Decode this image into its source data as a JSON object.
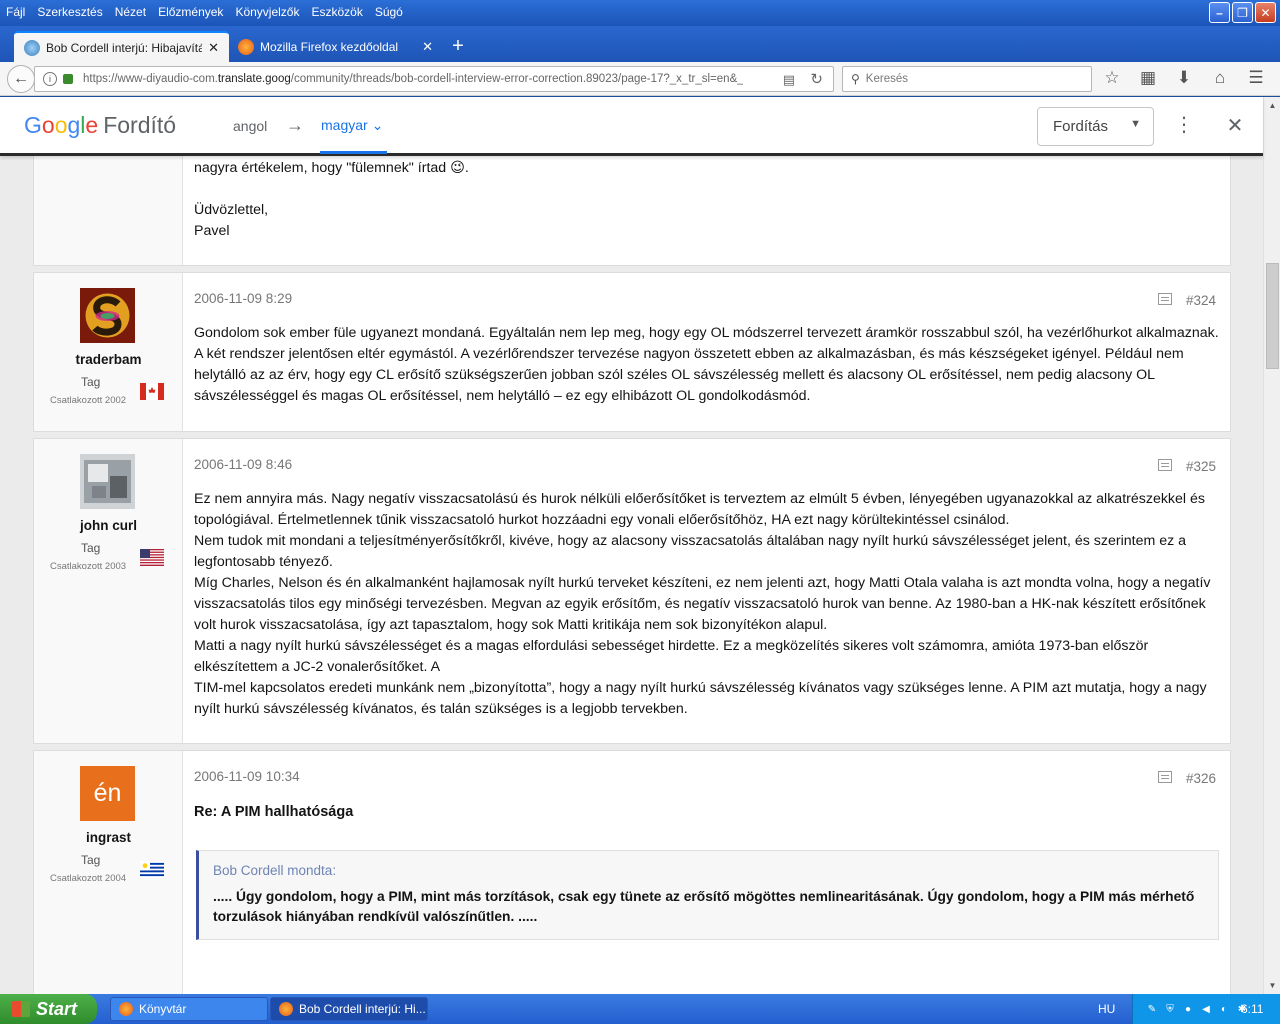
{
  "menu": [
    "Fájl",
    "Szerkesztés",
    "Nézet",
    "Előzmények",
    "Könyvjelzők",
    "Eszközök",
    "Súgó"
  ],
  "tabs": [
    {
      "title": "Bob Cordell interjú: Hibajavítá..."
    },
    {
      "title": "Mozilla Firefox kezdőoldal"
    }
  ],
  "nav": {
    "url_prefix": "https://www-diyaudio-com.",
    "url_domain": "translate.goog",
    "url_rest": "/community/threads/bob-cordell-interview-error-correction.89023/page-17?_x_tr_sl=en&_x_tr_",
    "search_placeholder": "Keresés"
  },
  "translate_bar": {
    "logo_letters": [
      "G",
      "o",
      "o",
      "g",
      "l",
      "e"
    ],
    "product": "Fordító",
    "source_lang": "angol",
    "target_lang": "magyar",
    "action": "Fordítás"
  },
  "posts": [
    {
      "body_lines": [
        "nagyra értékelem, hogy \"fülemnek\" írtad 😉.",
        "",
        "Üdvözlettel,",
        "Pavel"
      ]
    },
    {
      "user": "traderbam",
      "title": "Tag",
      "joined": "Csatlakozott 2002",
      "date": "2006-11-09 8:29",
      "num": "#324",
      "body": "Gondolom sok ember füle ugyanezt mondaná. Egyáltalán nem lep meg, hogy egy OL módszerrel tervezett áramkör rosszabbul szól, ha vezérlőhurkot alkalmaznak. A két rendszer jelentősen eltér egymástól. A vezérlőrendszer tervezése nagyon összetett ebben az alkalmazásban, és más készségeket igényel. Például nem helytálló az az érv, hogy egy CL erősítő szükségszerűen jobban szól széles OL sávszélesség mellett és alacsony OL erősítéssel, nem pedig alacsony OL sávszélességgel és magas OL erősítéssel, nem helytálló – ez egy elhibázott OL gondolkodásmód."
    },
    {
      "user": "john curl",
      "title": "Tag",
      "joined": "Csatlakozott 2003",
      "date": "2006-11-09 8:46",
      "num": "#325",
      "paragraphs": [
        "Ez nem annyira más. Nagy negatív visszacsatolású és hurok nélküli előerősítőket is terveztem az elmúlt 5 évben, lényegében ugyanazokkal az alkatrészekkel és topológiával. Értelmetlennek tűnik visszacsatoló hurkot hozzáadni egy vonali előerősítőhöz, HA ezt nagy körültekintéssel csinálod.",
        "Nem tudok mit mondani a teljesítményerősítőkről, kivéve, hogy az alacsony visszacsatolás általában nagy nyílt hurkú sávszélességet jelent, és szerintem ez a legfontosabb tényező.",
        "Míg Charles, Nelson és én alkalmanként hajlamosak nyílt hurkú terveket készíteni, ez nem jelenti azt, hogy Matti Otala valaha is azt mondta volna, hogy a negatív visszacsatolás tilos egy minőségi tervezésben. Megvan az egyik erősítőm, és negatív visszacsatoló hurok van benne. Az 1980-ban a HK-nak készített erősítőnek volt hurok visszacsatolása, így azt tapasztalom, hogy sok Matti kritikája nem sok bizonyítékon alapul.",
        "Matti a nagy nyílt hurkú sávszélességet és a magas elfordulási sebességet hirdette. Ez a megközelítés sikeres volt számomra, amióta 1973-ban először elkészítettem a JC-2 vonalerősítőket. A",
        "TIM-mel kapcsolatos eredeti munkánk nem „bizonyította”, hogy a nagy nyílt hurkú sávszélesség kívánatos vagy szükséges lenne. A PIM azt mutatja, hogy a nagy nyílt hurkú sávszélesség kívánatos, és talán szükséges is a legjobb tervekben."
      ]
    },
    {
      "user": "ingrast",
      "avatar_text": "én",
      "title": "Tag",
      "joined": "Csatlakozott 2004",
      "date": "2006-11-09 10:34",
      "num": "#326",
      "heading": "Re: A PIM hallhatósága",
      "quote_author": "Bob Cordell mondta:",
      "quote_text": "..... Úgy gondolom, hogy a PIM, mint más torzítások, csak egy tünete az erősítő mögöttes nemlinearitásának. Úgy gondolom, hogy a PIM más mérhető torzulások hiányában rendkívül valószínűtlen. ....."
    }
  ],
  "taskbar": {
    "start": "Start",
    "items": [
      "Könyvtár",
      "Bob Cordell interjú: Hi..."
    ],
    "lang": "HU",
    "time": "6:11"
  }
}
